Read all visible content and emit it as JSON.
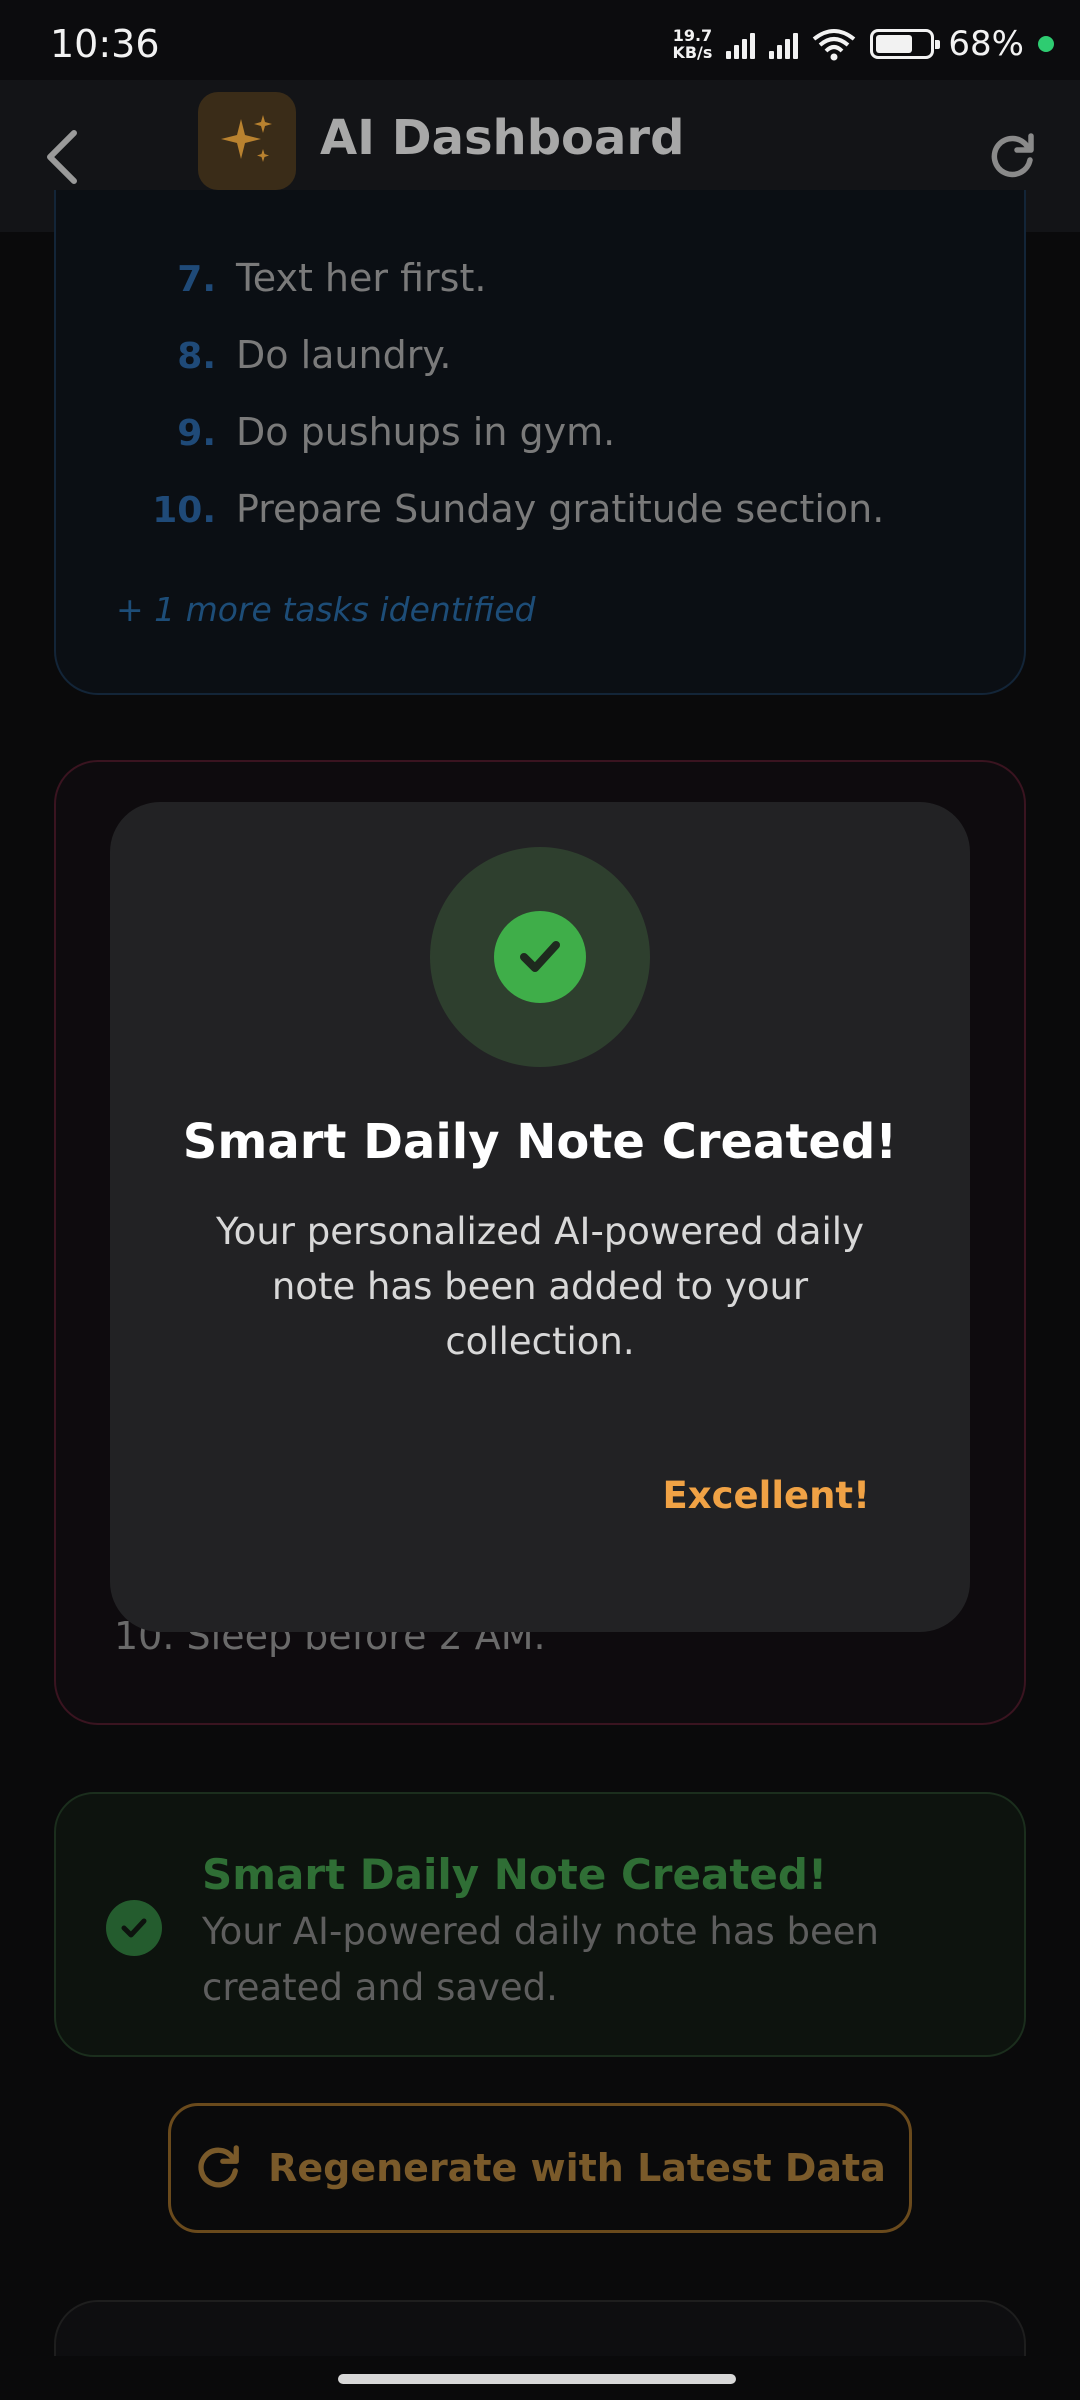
{
  "status_bar": {
    "time": "10:36",
    "net_speed_value": "19.7",
    "net_speed_unit": "KB/s",
    "battery_percent": "68%",
    "battery_level": 0.68
  },
  "app_bar": {
    "title": "AI Dashboard",
    "back_icon": "chevron-left-icon",
    "logo_icon": "sparkles-icon",
    "refresh_icon": "refresh-icon"
  },
  "tasks_card": {
    "items": [
      {
        "num": "7.",
        "text": "Text her first."
      },
      {
        "num": "8.",
        "text": "Do laundry."
      },
      {
        "num": "9.",
        "text": "Do pushups in gym."
      },
      {
        "num": "10.",
        "text": "Prepare Sunday gratitude section."
      }
    ],
    "more_text": "+ 1 more tasks identified"
  },
  "red_card": {
    "tail_item": "10. Sleep before 2 AM."
  },
  "dialog": {
    "title": "Smart Daily Note Created!",
    "message": "Your personalized AI-powered daily note has been added to your collection.",
    "action": "Excellent!",
    "icon": "check-circle-icon"
  },
  "success_card": {
    "title": "Smart Daily Note Created!",
    "description": "Your AI-powered daily note has been created and saved."
  },
  "regenerate_button": {
    "label": "Regenerate with Latest Data"
  },
  "colors": {
    "accent": "#f0a245",
    "success": "#3fae49",
    "task_number": "#1f4a78"
  }
}
